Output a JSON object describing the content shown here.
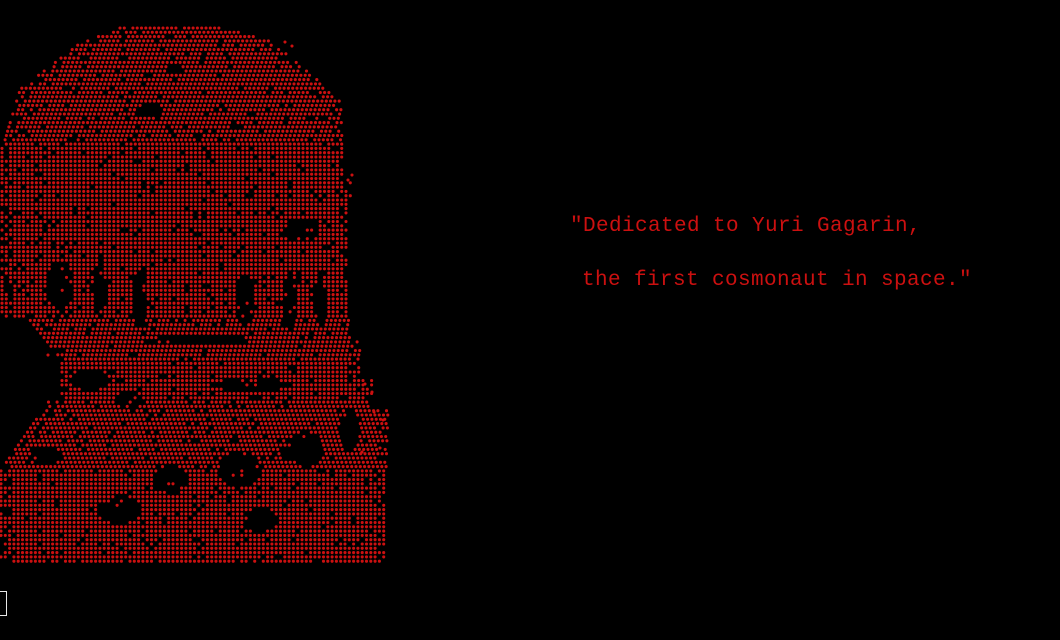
{
  "terminal": {
    "background_color": "#000000",
    "text_color": "#cc1010",
    "cursor_color": "#e8e8e8"
  },
  "portrait": {
    "style": "dot-matrix ascii portrait",
    "dot_color": "#cc1010"
  },
  "quote": {
    "line1": "\"Dedicated to Yuri Gagarin,",
    "line2": "the first cosmonaut in space.\""
  },
  "cursor": {
    "shape": "block-outline"
  }
}
